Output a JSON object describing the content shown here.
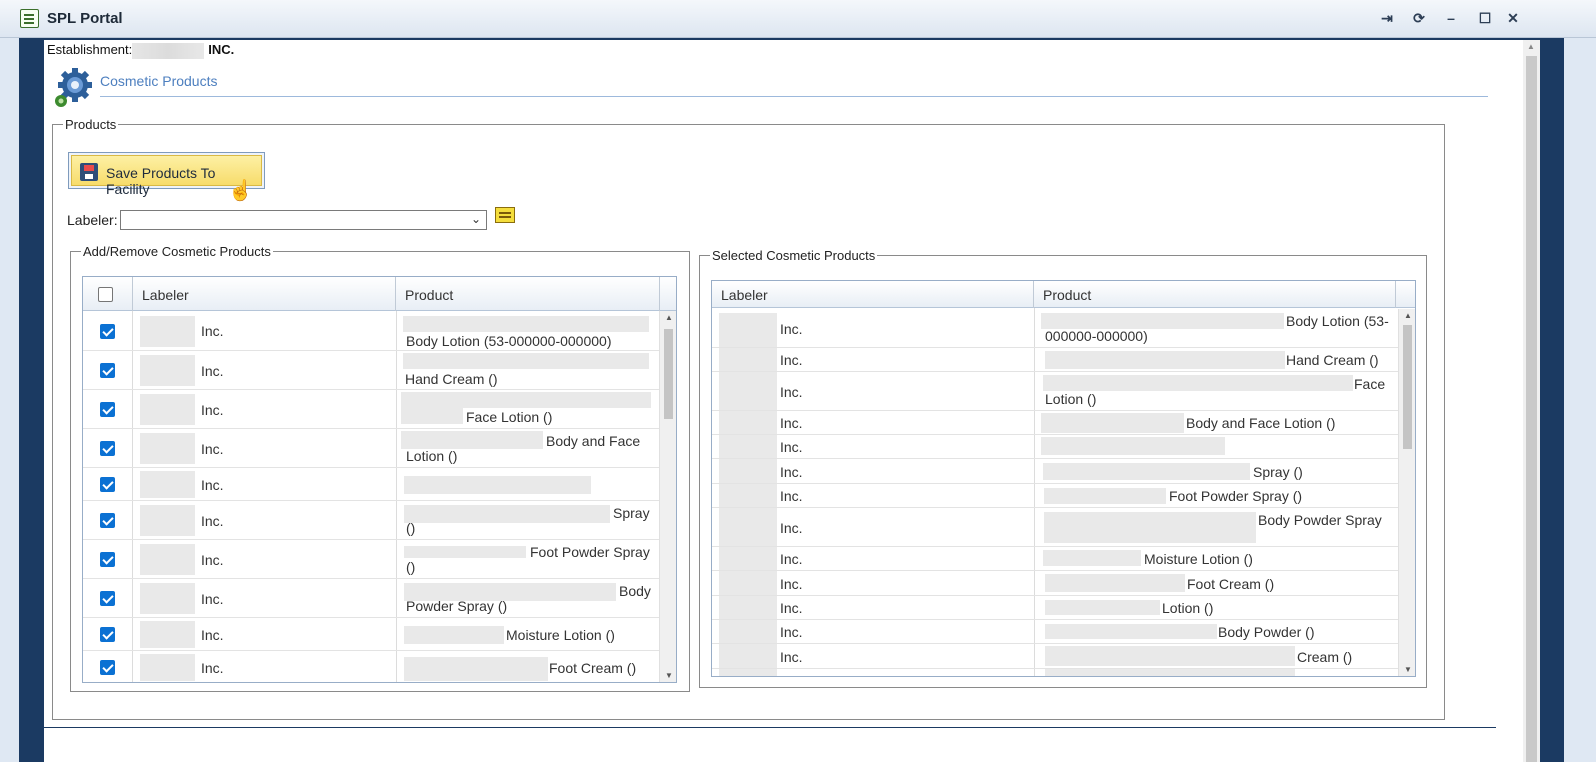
{
  "window": {
    "title": "SPL Portal",
    "controls": [
      "⇥",
      "⟳",
      "–",
      "☐",
      "✕"
    ]
  },
  "establishment": {
    "label": "Establishment:",
    "suffix": "INC."
  },
  "section": {
    "title": "Cosmetic Products"
  },
  "products_legend": "Products",
  "save_button": "Save Products To Facility",
  "labeler": {
    "label": "Labeler:",
    "value": ""
  },
  "add_remove": {
    "legend": "Add/Remove Cosmetic Products",
    "columns": [
      "Labeler",
      "Product"
    ],
    "rows": [
      {
        "labeler": "Inc.",
        "product": "Body Lotion (53-000000-000000)"
      },
      {
        "labeler": "Inc.",
        "product": "Hand Cream ()"
      },
      {
        "labeler": "Inc.",
        "product": "Face Lotion ()"
      },
      {
        "labeler": "Inc.",
        "product": "Body and Face",
        "product2": "Lotion ()"
      },
      {
        "labeler": "Inc.",
        "product": ""
      },
      {
        "labeler": "Inc.",
        "product": "Spray",
        "product2": "()"
      },
      {
        "labeler": "Inc.",
        "product": "Foot Powder Spray",
        "product2": "()"
      },
      {
        "labeler": "Inc.",
        "product": "Body",
        "product2": "Powder Spray ()"
      },
      {
        "labeler": "Inc.",
        "product": "Moisture Lotion ()"
      },
      {
        "labeler": "Inc.",
        "product": "Foot Cream ()"
      }
    ]
  },
  "selected": {
    "legend": "Selected Cosmetic Products",
    "columns": [
      "Labeler",
      "Product"
    ],
    "rows": [
      {
        "labeler": "Inc.",
        "product": "Body Lotion (53-",
        "product2": "000000-000000)"
      },
      {
        "labeler": "Inc.",
        "product": "Hand Cream ()"
      },
      {
        "labeler": "Inc.",
        "product": "Face",
        "product2": "Lotion ()"
      },
      {
        "labeler": "Inc.",
        "product": "Body and Face Lotion ()"
      },
      {
        "labeler": "Inc.",
        "product": ""
      },
      {
        "labeler": "Inc.",
        "product": "Spray ()"
      },
      {
        "labeler": "Inc.",
        "product": "Foot Powder Spray ()"
      },
      {
        "labeler": "Inc.",
        "product": "Body Powder Spray"
      },
      {
        "labeler": "Inc.",
        "product": "Moisture Lotion ()"
      },
      {
        "labeler": "Inc.",
        "product": "Foot Cream ()"
      },
      {
        "labeler": "Inc.",
        "product": "Lotion ()"
      },
      {
        "labeler": "Inc.",
        "product": "Body Powder ()"
      },
      {
        "labeler": "Inc.",
        "product": "Cream ()"
      }
    ]
  }
}
